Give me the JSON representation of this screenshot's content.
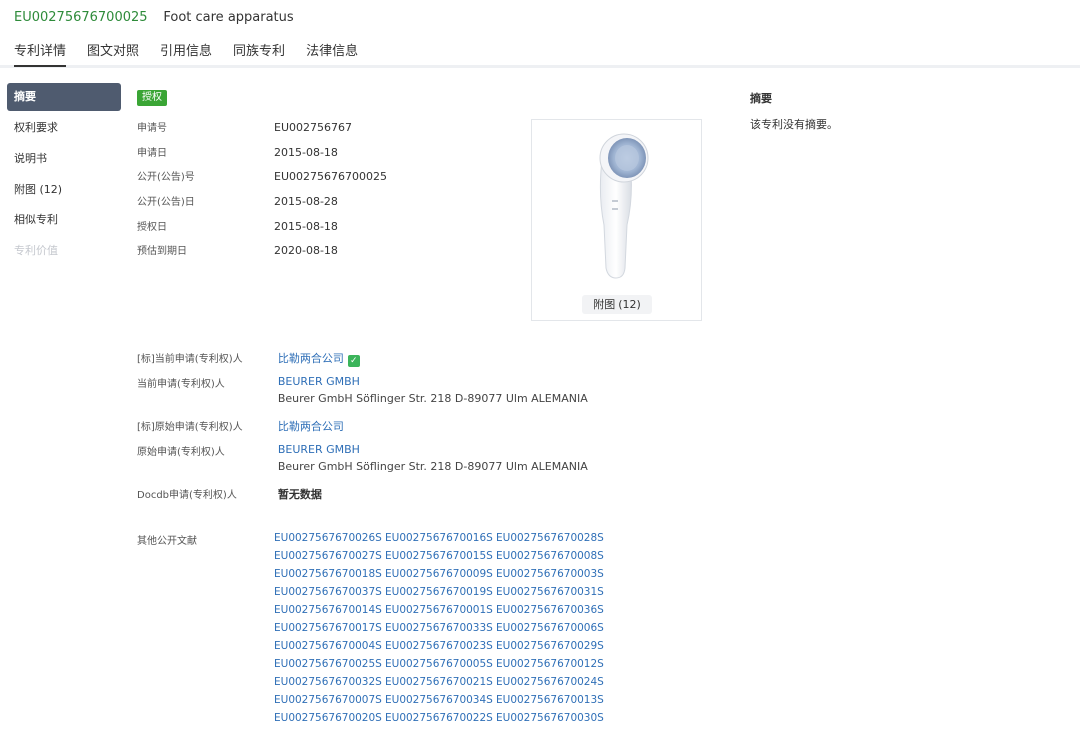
{
  "header": {
    "pub_no": "EU00275676700025",
    "title": "Foot care apparatus",
    "tabs": [
      "专利详情",
      "图文对照",
      "引用信息",
      "同族专利",
      "法律信息"
    ]
  },
  "nav": [
    "摘要",
    "权利要求",
    "说明书",
    "附图 (12)",
    "相似专利",
    "专利价值"
  ],
  "status_badge": "授权",
  "info": [
    {
      "label": "申请号",
      "value": "EU002756767"
    },
    {
      "label": "申请日",
      "value": "2015-08-18"
    },
    {
      "label": "公开(公告)号",
      "value": "EU00275676700025"
    },
    {
      "label": "公开(公告)日",
      "value": "2015-08-28"
    },
    {
      "label": "授权日",
      "value": "2015-08-18"
    },
    {
      "label": "预估到期日",
      "value": "2020-08-18"
    }
  ],
  "figure": {
    "button_label": "附图",
    "count": "(12)"
  },
  "applicants": {
    "current_std_label": "[标]当前申请(专利权)人",
    "current_std_value": "比勒两合公司",
    "current_label": "当前申请(专利权)人",
    "current_name": "BEURER GMBH",
    "current_addr": "Beurer GmbH Söflinger Str. 218 D-89077 Ulm ALEMANIA",
    "orig_std_label": "[标]原始申请(专利权)人",
    "orig_std_value": "比勒两合公司",
    "orig_label": "原始申请(专利权)人",
    "orig_name": "BEURER GMBH",
    "orig_addr": "Beurer GmbH Söflinger Str. 218 D-89077 Ulm ALEMANIA",
    "docdb_label": "Docdb申请(专利权)人",
    "docdb_value": "暂无数据"
  },
  "others": {
    "label": "其他公开文献",
    "docs": [
      "EU0027567670026S",
      "EU0027567670016S",
      "EU0027567670028S",
      "EU0027567670027S",
      "EU0027567670015S",
      "EU0027567670008S",
      "EU0027567670018S",
      "EU0027567670009S",
      "EU0027567670003S",
      "EU0027567670037S",
      "EU0027567670019S",
      "EU0027567670031S",
      "EU0027567670014S",
      "EU0027567670001S",
      "EU0027567670036S",
      "EU0027567670017S",
      "EU0027567670033S",
      "EU0027567670006S",
      "EU0027567670004S",
      "EU0027567670023S",
      "EU0027567670029S",
      "EU0027567670025S",
      "EU0027567670005S",
      "EU0027567670012S",
      "EU0027567670032S",
      "EU0027567670021S",
      "EU0027567670024S",
      "EU0027567670007S",
      "EU0027567670034S",
      "EU0027567670013S",
      "EU0027567670020S",
      "EU0027567670022S",
      "EU0027567670030S"
    ]
  },
  "abstract": {
    "title": "摘要",
    "text": "该专利没有摘要。"
  },
  "colors": {
    "accent_green": "#2e8b3a",
    "badge_green": "#3aa535",
    "link_blue": "#2f6fb7",
    "nav_active": "#4f5b6f"
  }
}
